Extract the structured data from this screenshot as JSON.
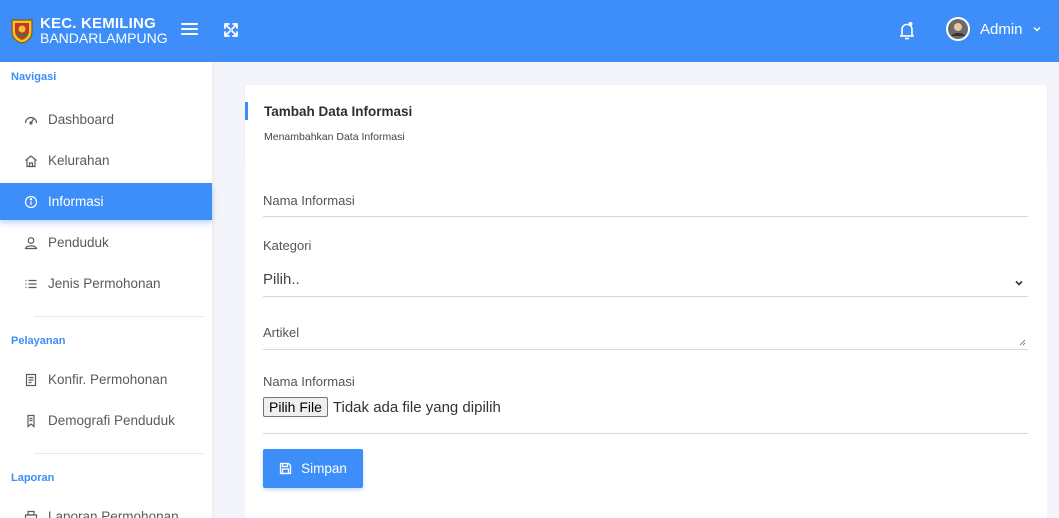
{
  "brand": {
    "line1": "KEC. KEMILING",
    "line2": "BANDARLAMPUNG"
  },
  "header": {
    "user_name": "Admin"
  },
  "sidebar": {
    "sections": [
      {
        "label": "Navigasi"
      },
      {
        "label": "Pelayanan"
      },
      {
        "label": "Laporan"
      }
    ],
    "items": [
      {
        "label": "Dashboard",
        "icon": "dashboard-icon"
      },
      {
        "label": "Kelurahan",
        "icon": "home-icon"
      },
      {
        "label": "Informasi",
        "icon": "info-icon",
        "active": true
      },
      {
        "label": "Penduduk",
        "icon": "user-icon"
      },
      {
        "label": "Jenis Permohonan",
        "icon": "list-icon"
      },
      {
        "label": "Konfir. Permohonan",
        "icon": "document-icon"
      },
      {
        "label": "Demografi Penduduk",
        "icon": "bookmark-icon"
      },
      {
        "label": "Laporan Permohonan",
        "icon": "printer-icon"
      }
    ]
  },
  "page": {
    "title": "Tambah Data Informasi",
    "subtitle": "Menambahkan Data Informasi"
  },
  "form": {
    "name_placeholder": "Nama Informasi",
    "category_label": "Kategori",
    "category_value": "Pilih..",
    "article_placeholder": "Artikel",
    "file_label": "Nama Informasi",
    "file_button": "Pilih File",
    "file_status": "Tidak ada file yang dipilih",
    "save_label": "Simpan"
  },
  "colors": {
    "accent": "#3d8ef8",
    "background": "#f4f5fa"
  }
}
